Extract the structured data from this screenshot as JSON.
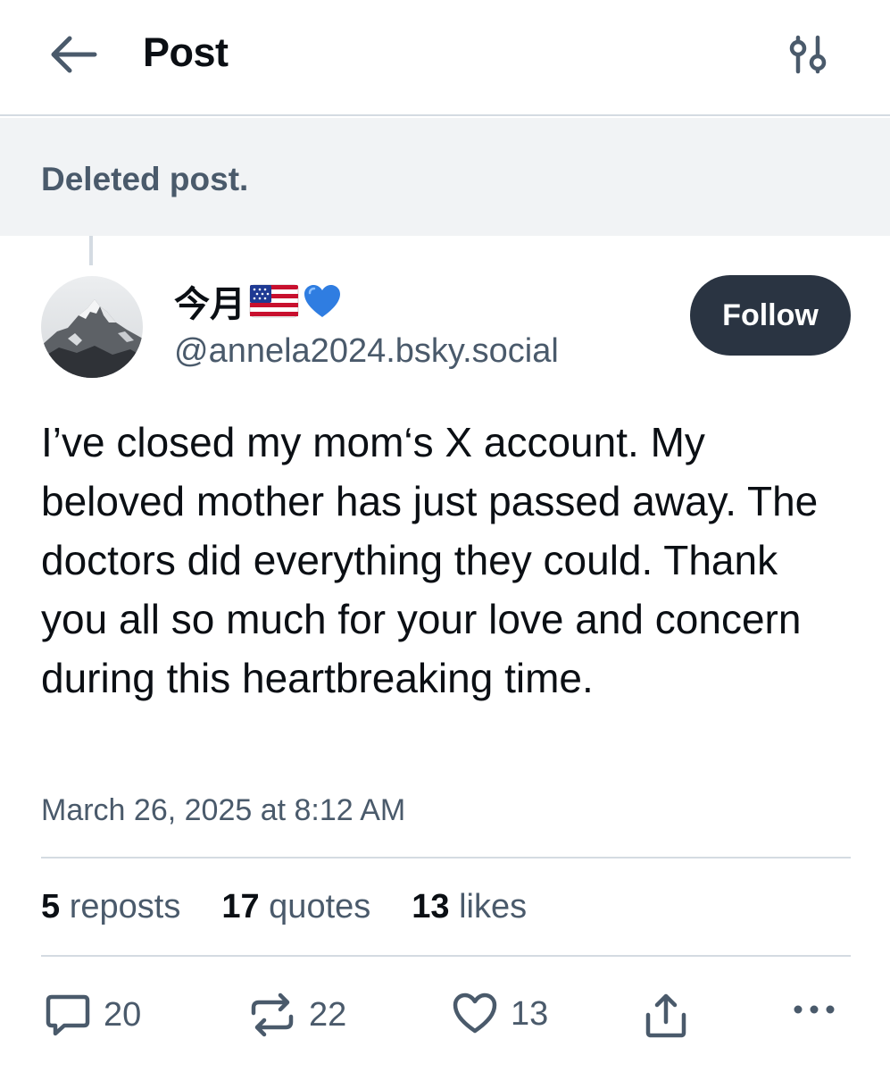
{
  "header": {
    "title": "Post",
    "back_icon": "arrow-left-icon",
    "settings_icon": "sliders-icon"
  },
  "parent": {
    "text": "Deleted post."
  },
  "author": {
    "display_name": "今月",
    "name_emojis": [
      "us-flag-emoji",
      "blue-heart-emoji"
    ],
    "handle": "@annela2024.bsky.social",
    "avatar": "mountain-photo-avatar"
  },
  "follow_label": "Follow",
  "post": {
    "text": "I’ve closed my mom‘s X account. My beloved mother has just passed away. The doctors did everything they could. Thank you all so much for your love and concern during this heartbreaking time.",
    "timestamp": "March 26, 2025 at 8:12 AM"
  },
  "stats": [
    {
      "count": "5",
      "label": "reposts"
    },
    {
      "count": "17",
      "label": "quotes"
    },
    {
      "count": "13",
      "label": "likes"
    }
  ],
  "actions": {
    "reply_count": "20",
    "repost_count": "22",
    "like_count": "13"
  },
  "colors": {
    "accent_button": "#2a3442",
    "muted_text": "#4a5a6b",
    "divider": "#d4dbe2",
    "deleted_bg": "#f1f3f5"
  }
}
